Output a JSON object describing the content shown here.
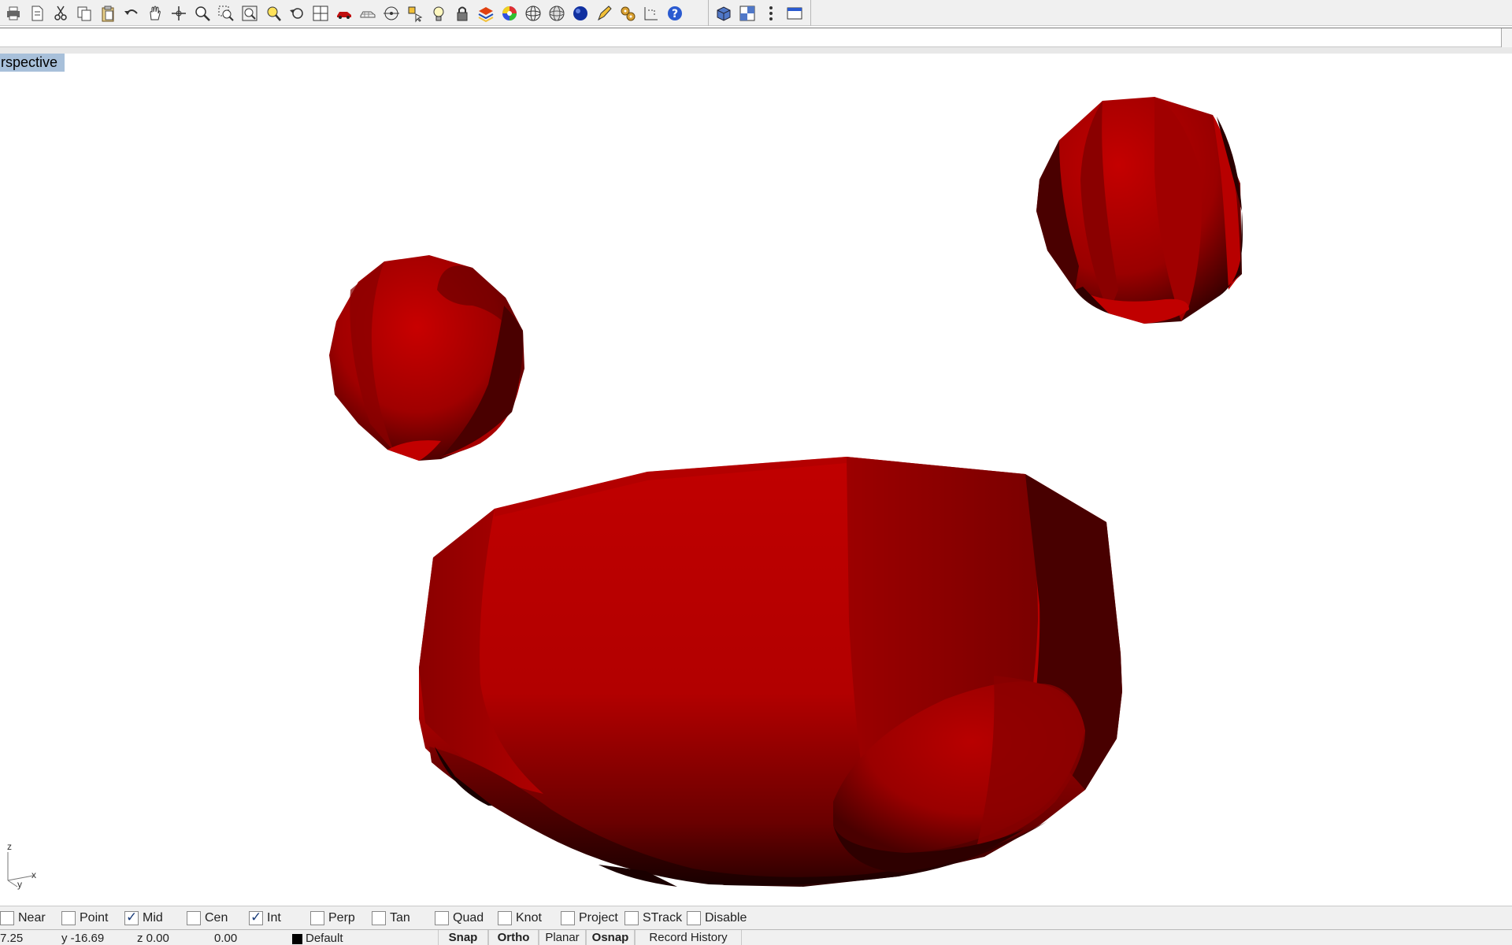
{
  "toolbar": {
    "groups": [
      {
        "buttons": [
          {
            "name": "print-icon",
            "kind": "printer"
          },
          {
            "name": "properties-icon",
            "kind": "doc"
          },
          {
            "name": "cut-icon",
            "kind": "cut"
          },
          {
            "name": "copy-icon",
            "kind": "copy"
          },
          {
            "name": "paste-icon",
            "kind": "paste"
          },
          {
            "name": "undo-icon",
            "kind": "undo"
          },
          {
            "name": "pan-hand-icon",
            "kind": "hand"
          },
          {
            "name": "rotate-view-icon",
            "kind": "move"
          },
          {
            "name": "zoom-icon",
            "kind": "zoom"
          },
          {
            "name": "zoom-window-icon",
            "kind": "zoomwin"
          },
          {
            "name": "zoom-extents-icon",
            "kind": "zoomext"
          },
          {
            "name": "zoom-selected-icon",
            "kind": "zoomsel"
          },
          {
            "name": "undo-view-change-icon",
            "kind": "undoview"
          },
          {
            "name": "four-viewports-icon",
            "kind": "grid"
          },
          {
            "name": "car-icon",
            "kind": "car"
          },
          {
            "name": "wireframe-car-icon",
            "kind": "car2"
          },
          {
            "name": "cplane-icon",
            "kind": "circletarget"
          },
          {
            "name": "select-filter-icon",
            "kind": "select"
          },
          {
            "name": "light-bulb-icon",
            "kind": "bulb"
          },
          {
            "name": "lock-icon",
            "kind": "lock"
          },
          {
            "name": "layers-icon",
            "kind": "layers"
          },
          {
            "name": "color-wheel-icon",
            "kind": "colorwheel"
          },
          {
            "name": "sphere-wireframe-icon",
            "kind": "wiresphere"
          },
          {
            "name": "ghosted-sphere-icon",
            "kind": "ghostsphere"
          },
          {
            "name": "rendered-sphere-icon",
            "kind": "bluesphere"
          },
          {
            "name": "highlighter-icon",
            "kind": "pen"
          },
          {
            "name": "options-gear-icon",
            "kind": "gears"
          },
          {
            "name": "dimension-icon",
            "kind": "dim"
          },
          {
            "name": "help-icon",
            "kind": "help"
          }
        ]
      },
      {
        "buttons": [
          {
            "name": "shaded-box-icon",
            "kind": "box"
          },
          {
            "name": "viewport-layout-icon",
            "kind": "vplayout"
          },
          {
            "name": "vertical-dots-icon",
            "kind": "vdots"
          },
          {
            "name": "window-icon",
            "kind": "window"
          }
        ]
      }
    ]
  },
  "command": {
    "value": ""
  },
  "viewport": {
    "title": "rspective"
  },
  "axis": {
    "z": "z",
    "x": "x",
    "y": "y"
  },
  "model": {
    "color": "#c00000",
    "shadow": "#3d0000"
  },
  "osnap": [
    {
      "label": "Near",
      "checked": false
    },
    {
      "label": "Point",
      "checked": false
    },
    {
      "label": "Mid",
      "checked": true
    },
    {
      "label": "Cen",
      "checked": false
    },
    {
      "label": "Int",
      "checked": true
    },
    {
      "label": "Perp",
      "checked": false
    },
    {
      "label": "Tan",
      "checked": false
    },
    {
      "label": "Quad",
      "checked": false
    },
    {
      "label": "Knot",
      "checked": false
    },
    {
      "label": "Project",
      "checked": false
    },
    {
      "label": "STrack",
      "checked": false
    },
    {
      "label": "Disable",
      "checked": false
    }
  ],
  "status": {
    "x": "7.25",
    "y": "y -16.69",
    "z": "z 0.00",
    "distance": "0.00",
    "layer": "Default",
    "panes": {
      "snap": "Snap",
      "ortho": "Ortho",
      "planar": "Planar",
      "osnap": "Osnap",
      "record_history": "Record History"
    }
  }
}
